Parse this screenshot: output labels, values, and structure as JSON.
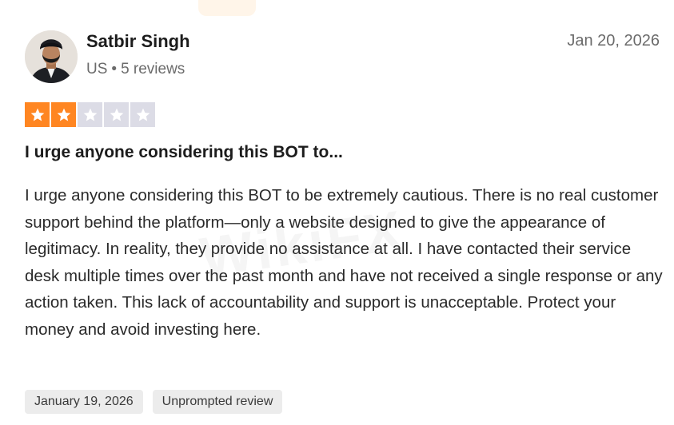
{
  "reviewer": {
    "name": "Satbir Singh",
    "country": "US",
    "separator": "•",
    "review_count": "5 reviews"
  },
  "review": {
    "date": "Jan 20, 2026",
    "rating": 2,
    "rating_max": 5,
    "title": "I urge anyone considering this BOT to...",
    "body": "I urge anyone considering this BOT to be extremely cautious. There is no real customer support behind the platform—only a website designed to give the appearance of legitimacy. In reality, they provide no assistance at all. I have contacted their service desk multiple times over the past month and have not received a single response or any action taken. This lack of accountability and support is unacceptable. Protect your money and avoid investing here.",
    "tags": [
      "January 19, 2026",
      "Unprompted review"
    ]
  },
  "colors": {
    "star_filled": "#ff8622",
    "star_empty": "#dcdce6"
  },
  "icons": {
    "star": "star-icon",
    "avatar": "avatar"
  }
}
